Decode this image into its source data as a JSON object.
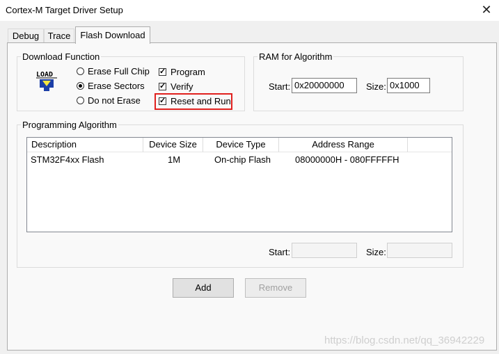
{
  "window": {
    "title": "Cortex-M Target Driver Setup",
    "close_glyph": "✕"
  },
  "tabs": [
    {
      "label": "Debug",
      "active": false
    },
    {
      "label": "Trace",
      "active": false
    },
    {
      "label": "Flash Download",
      "active": true
    }
  ],
  "download_function": {
    "legend": "Download Function",
    "load_icon": "load-icon",
    "load_text": "LOAD",
    "erase_options": [
      {
        "label": "Erase Full Chip",
        "selected": false
      },
      {
        "label": "Erase Sectors",
        "selected": true
      },
      {
        "label": "Do not Erase",
        "selected": false
      }
    ],
    "checkboxes": [
      {
        "label": "Program",
        "checked": true
      },
      {
        "label": "Verify",
        "checked": true
      },
      {
        "label": "Reset and Run",
        "checked": true
      }
    ],
    "highlight_color": "#e0201e"
  },
  "ram": {
    "legend": "RAM for Algorithm",
    "start_label": "Start:",
    "start_value": "0x20000000",
    "size_label": "Size:",
    "size_value": "0x1000"
  },
  "programming_algorithm": {
    "legend": "Programming Algorithm",
    "columns": [
      "Description",
      "Device Size",
      "Device Type",
      "Address Range"
    ],
    "rows": [
      [
        "STM32F4xx Flash",
        "1M",
        "On-chip Flash",
        "08000000H - 080FFFFFH"
      ]
    ],
    "start_label": "Start:",
    "start_value": "",
    "size_label": "Size:",
    "size_value": ""
  },
  "buttons": {
    "add": "Add",
    "remove": "Remove"
  },
  "watermark": "https://blog.csdn.net/qq_36942229"
}
